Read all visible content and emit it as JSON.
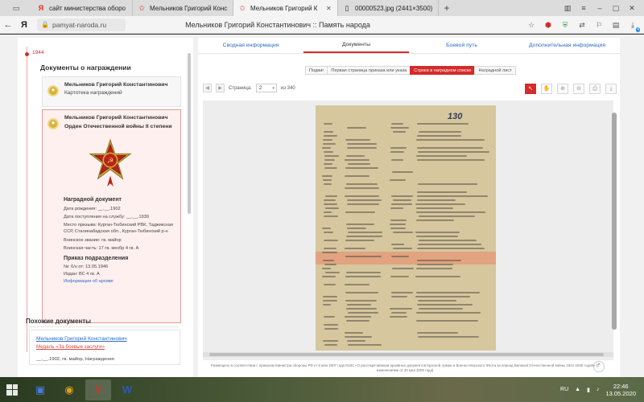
{
  "browser": {
    "tabs": [
      {
        "label": "сайт министерства оборо",
        "favicon": "yandex-icon",
        "active": false
      },
      {
        "label": "Мельников Григорий Конс",
        "favicon": "star-icon",
        "active": false
      },
      {
        "label": "Мельников Григорий К",
        "favicon": "star-icon",
        "active": true
      },
      {
        "label": "00000523.jpg (2441×3500)",
        "favicon": "page-icon",
        "active": false
      }
    ],
    "new_tab": "+",
    "url": "pamyat-naroda.ru",
    "page_title": "Мельников Григорий Константинович :: Память народа",
    "download_badge": "4"
  },
  "left": {
    "year": "1944",
    "section_title": "Документы о награждении",
    "card1": {
      "name": "Мельников Григорий Константинович",
      "subtitle": "Картотека награждений"
    },
    "card2": {
      "name": "Мельников Григорий Константинович",
      "subtitle": "Орден Отечественной войны II степени",
      "award_doc_title": "Наградной документ",
      "birth_date": "Дата рождения: __.__.1902",
      "service_date": "Дата поступления на службу: __.__.1939",
      "draft_place": "Место призыва: Курган-Тюбинский РВК, Таджикская ССР, Сталинабадская обл., Курган-Тюбинский р-н",
      "rank": "Воинское звание: гв. майор",
      "unit": "Воинская часть: 17 гв. мехбр 4 гв. А",
      "order_title": "Приказ подразделения",
      "order_number": "№: 6/н от: 13.05.1946",
      "issued_by": "Издан: ВС 4 гв. А",
      "archive_link": "Информация об архиве"
    },
    "similar_title": "Похожие документы",
    "similar": {
      "name": "Мельников Григорий Константинович",
      "subtitle": "Медаль «За боевые заслуги»",
      "meta": "__.__.1902, гв. майор, Награждения"
    }
  },
  "right": {
    "top_tabs": [
      "Сводная информация",
      "Документы",
      "Боевой путь",
      "Дополнительная информация"
    ],
    "active_top_tab": 1,
    "sub_tabs": [
      "Подвиг",
      "Первая страница приказа или указа",
      "Строка в наградном списке",
      "Наградной лист"
    ],
    "active_sub_tab": 2,
    "pager": {
      "label": "Страница:",
      "current": "2",
      "of_label": "из 340"
    },
    "stamp_text": "130",
    "footnote": "Размещено в соответствии с приказом Министра обороны РФ от 8 мая 2007 года N181 «О рассекречивании архивных документов Красной Армии и Военно-Морского Флота за период Великой Отечественной войны 1941-1945 годов» (с изменениями от 30 мая 2009 года)"
  },
  "taskbar": {
    "language": "RU",
    "time": "22:46",
    "date": "13.05.2020"
  },
  "colors": {
    "accent": "#d62a2a",
    "link": "#2a6bc7"
  }
}
